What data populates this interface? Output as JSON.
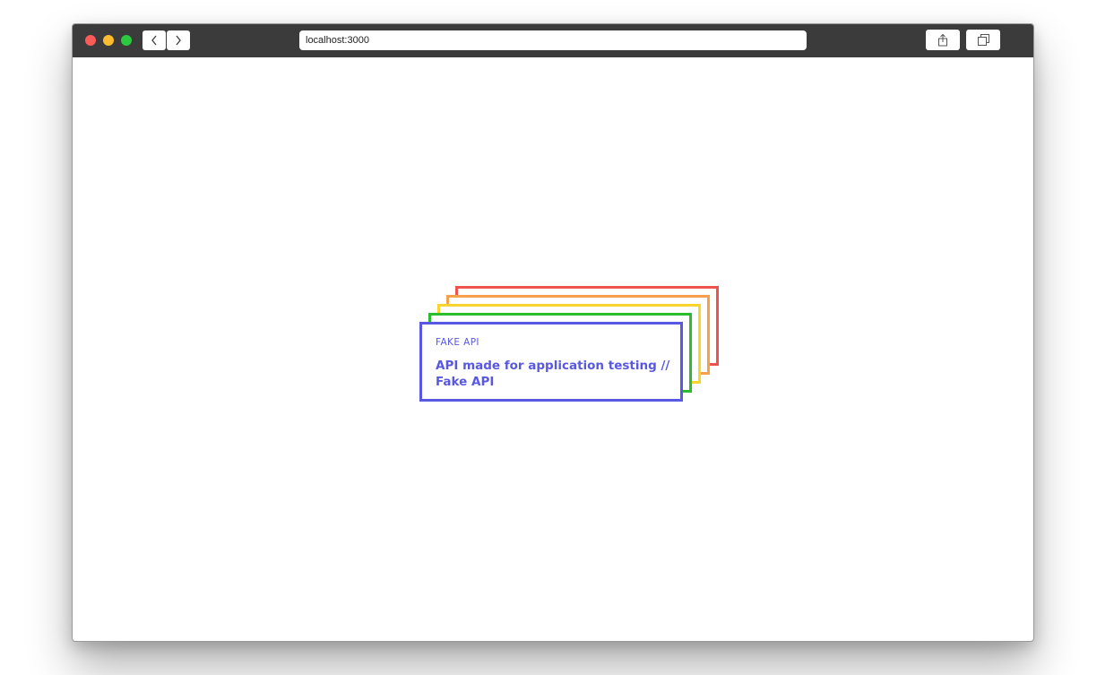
{
  "browser": {
    "url": "localhost:3000"
  },
  "card": {
    "label": "FAKE API",
    "title": "API made for application testing // Fake API"
  },
  "colors": {
    "titlebar": "#3b3b3b",
    "card_stack": [
      "#ef5350",
      "#f6a04d",
      "#f9d42e",
      "#2cbc30",
      "#5858e2"
    ]
  },
  "icons": [
    "chevron-left-icon",
    "chevron-right-icon",
    "share-icon",
    "tabs-icon"
  ]
}
